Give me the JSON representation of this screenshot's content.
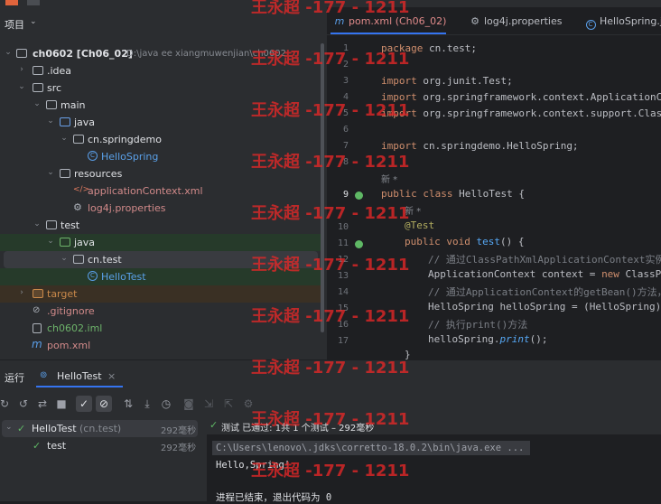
{
  "project": {
    "header": "项目",
    "tree": [
      {
        "label": "ch0602 [Ch06_02]",
        "extra": "D:\\java ee xiangmuwenjian\\ch0602",
        "icon": "folder-icon",
        "arrow": "down"
      },
      {
        "label": ".idea",
        "icon": "folder-icon",
        "arrow": "right"
      },
      {
        "label": "src",
        "icon": "folder-icon",
        "arrow": "down"
      },
      {
        "label": "main",
        "icon": "folder-icon",
        "arrow": "down"
      },
      {
        "label": "java",
        "icon": "source-folder-icon",
        "arrow": "down"
      },
      {
        "label": "cn.springdemo",
        "icon": "package-icon",
        "arrow": "down"
      },
      {
        "label": "HelloSpring",
        "icon": "class-icon",
        "arrow": ""
      },
      {
        "label": "resources",
        "icon": "resources-folder-icon",
        "arrow": "down"
      },
      {
        "label": "applicationContext.xml",
        "icon": "xml-file-icon",
        "arrow": ""
      },
      {
        "label": "log4j.properties",
        "icon": "properties-file-icon",
        "arrow": ""
      },
      {
        "label": "test",
        "icon": "folder-icon",
        "arrow": "down"
      },
      {
        "label": "java",
        "icon": "test-source-folder-icon",
        "arrow": "down"
      },
      {
        "label": "cn.test",
        "icon": "package-icon",
        "arrow": "down"
      },
      {
        "label": "HelloTest",
        "icon": "class-icon",
        "arrow": ""
      },
      {
        "label": "target",
        "icon": "excluded-folder-icon",
        "arrow": "right"
      },
      {
        "label": ".gitignore",
        "icon": "gitignore-file-icon",
        "arrow": ""
      },
      {
        "label": "ch0602.iml",
        "icon": "iml-file-icon",
        "arrow": ""
      },
      {
        "label": "pom.xml",
        "icon": "maven-file-icon",
        "arrow": ""
      }
    ]
  },
  "editor": {
    "tabs": [
      {
        "label": "pom.xml (Ch06_02)",
        "icon": "maven-file-icon",
        "color": "#e08a8a"
      },
      {
        "label": "log4j.properties",
        "icon": "gear-icon",
        "color": "#bcbec4"
      },
      {
        "label": "HelloSpring.ja",
        "icon": "class-icon",
        "color": "#bcbec4"
      }
    ],
    "line_numbers": [
      "1",
      "2",
      "3",
      "4",
      "5",
      "6",
      "7",
      "8",
      "9",
      "10",
      "11",
      "12",
      "13",
      "14",
      "15",
      "16",
      "17"
    ],
    "code": {
      "l1_kw": "package",
      "l1_rest": " cn.test;",
      "l3_kw": "import",
      "l3_rest": " org.junit.Test;",
      "l4_kw": "import",
      "l4_rest": " org.springframework.context.ApplicationCo",
      "l5_kw": "import",
      "l5_rest": " org.springframework.context.support.Class",
      "l7_kw": "import",
      "l7_rest": " cn.springdemo.HelloSpring;",
      "hint_new": "新 *",
      "l9_kw": "public class",
      "l9_rest": " HelloTest {",
      "hint_new2": "新 *",
      "l10": "@Test",
      "l11_kw": "public void",
      "l11_fn": "test",
      "l11_rest": "() {",
      "l12": "// 通过ClassPathXmlApplicationContext实例化",
      "l13_a": "ApplicationContext context = ",
      "l13_kw": "new",
      "l13_b": " ClassPat",
      "l14": "// 通过ApplicationContext的getBean()方法，获",
      "l15": "HelloSpring helloSpring = (HelloSpring)",
      "l16": "// 执行print()方法",
      "l17_a": "helloSpring.",
      "l17_fn": "print",
      "l17_b": "();",
      "l18": "}"
    }
  },
  "run": {
    "label": "运行",
    "tab": "HelloTest",
    "status": "测试 已通过: 1共 1 个测试 – 292毫秒",
    "tests": [
      {
        "name": "HelloTest",
        "pkg": "(cn.test)",
        "time": "292毫秒"
      },
      {
        "name": "test",
        "pkg": "",
        "time": "292毫秒"
      }
    ],
    "console": [
      "C:\\Users\\lenovo\\.jdks\\corretto-18.0.2\\bin\\java.exe ...",
      "Hello,Spring!",
      "",
      "进程已结束，退出代码为 0"
    ]
  },
  "watermark": "王永超 -177 - 1211"
}
